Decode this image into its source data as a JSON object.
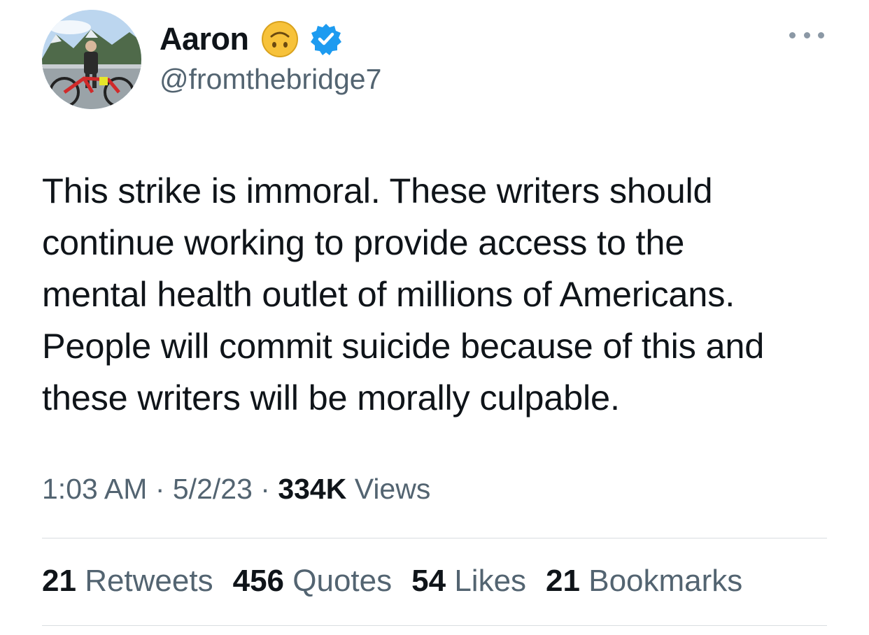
{
  "author": {
    "display_name": "Aaron",
    "handle": "@fromthebridge7",
    "name_emoji": "upside-down-face-emoji",
    "verified_badge": "verified-badge-icon",
    "avatar": "avatar-photo"
  },
  "menu": {
    "icon": "more-options-icon"
  },
  "tweet": {
    "lines": [
      "This strike is immoral. These writers should",
      "continue working to provide access to the",
      "mental health outlet of millions of Americans.",
      "People will commit suicide because of this and",
      "these writers will be morally culpable."
    ]
  },
  "meta": {
    "time": "1:03 AM",
    "sep1": " · ",
    "date": "5/2/23",
    "sep2": " · ",
    "views_count": "334K",
    "views_label": " Views"
  },
  "stats": [
    {
      "count": "21",
      "label": "Retweets"
    },
    {
      "count": "456",
      "label": "Quotes"
    },
    {
      "count": "54",
      "label": "Likes"
    },
    {
      "count": "21",
      "label": "Bookmarks"
    }
  ],
  "colors": {
    "text": "#0f1419",
    "secondary": "#536471",
    "verified_blue": "#1d9bf0",
    "divider": "#d9dde0",
    "emoji_yellow": "#f7c23a"
  }
}
